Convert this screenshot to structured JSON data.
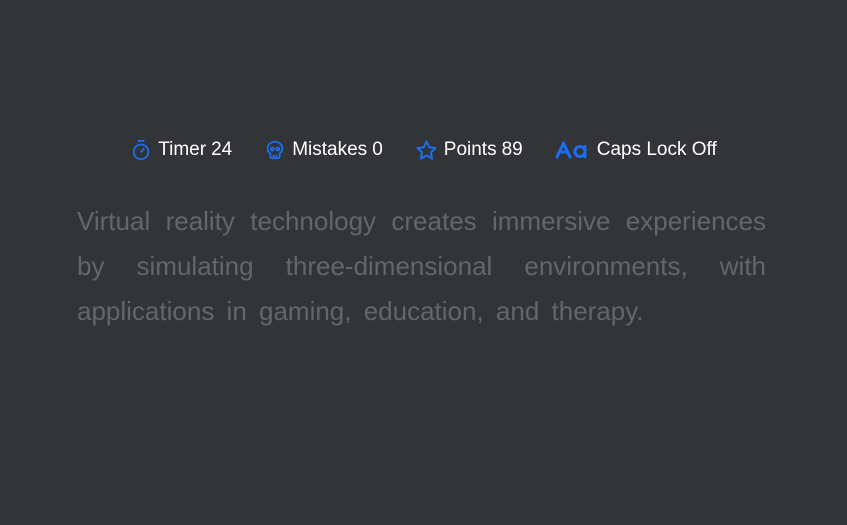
{
  "stats": {
    "timer": {
      "label": "Timer",
      "value": "24",
      "icon": "stopwatch-icon"
    },
    "mistakes": {
      "label": "Mistakes",
      "value": "0",
      "icon": "skull-icon"
    },
    "points": {
      "label": "Points",
      "value": "89",
      "icon": "star-icon"
    },
    "caps_lock": {
      "label": "Caps Lock Off",
      "icon": "letter-case-icon"
    }
  },
  "typing_text": "Virtual reality technology creates immersive experiences by simulating three-dimensional environments, with applications in gaming, education, and therapy.",
  "colors": {
    "background": "#323437",
    "accent": "#1a6ff0",
    "stat_text": "#ffffff",
    "untyped_text": "#646669"
  }
}
